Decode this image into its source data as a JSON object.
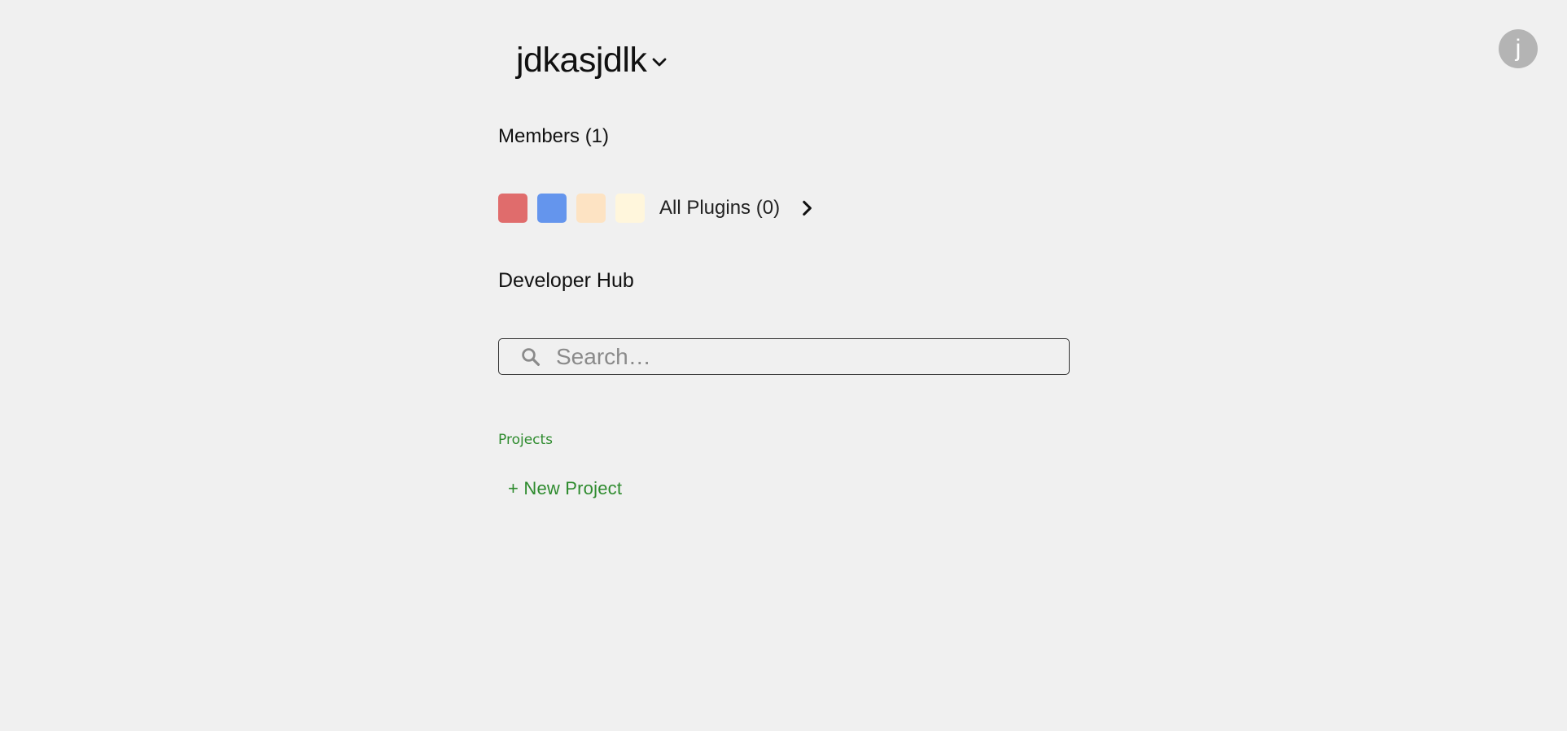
{
  "header": {
    "workspace_name": "jdkasjdlk",
    "avatar_initial": "j"
  },
  "members": {
    "label": "Members (1)"
  },
  "plugins": {
    "swatch_colors": [
      "#e06c6c",
      "#6495ed",
      "#fde3c3",
      "#fff6dc"
    ],
    "label": "All Plugins (0)"
  },
  "developer_hub": {
    "title": "Developer Hub"
  },
  "search": {
    "placeholder": "Search…",
    "value": ""
  },
  "projects": {
    "section_label": "Projects",
    "new_project_label": "+ New Project"
  },
  "colors": {
    "background": "#f0f0f0",
    "accent_green": "#2e8b2e",
    "avatar_bg": "#b4b4b4"
  }
}
